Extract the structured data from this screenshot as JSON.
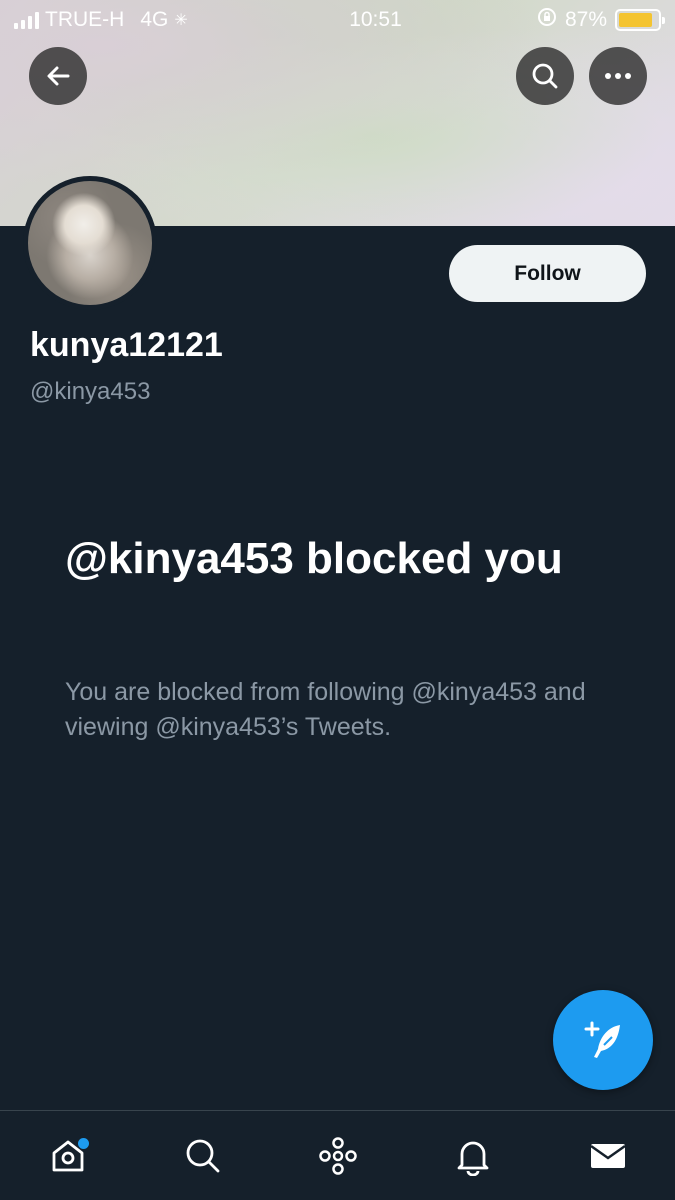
{
  "status_bar": {
    "carrier": "TRUE-H",
    "network": "4G",
    "time": "10:51",
    "battery": "87%",
    "battery_level": 0.87
  },
  "header": {
    "back_icon": "back-arrow-icon",
    "search_icon": "search-icon",
    "more_icon": "more-icon"
  },
  "profile": {
    "display_name": "kunya12121",
    "handle": "@kinya453",
    "follow_label": "Follow"
  },
  "blocked": {
    "title": "@kinya453 blocked you",
    "description": "You are blocked from following @kinya453 and viewing @kinya453’s Tweets."
  },
  "fab": {
    "icon": "compose-tweet-icon"
  },
  "tabs": [
    {
      "name": "home",
      "icon": "home-icon",
      "has_notification_dot": true
    },
    {
      "name": "search",
      "icon": "search-icon"
    },
    {
      "name": "spaces",
      "icon": "spaces-icon"
    },
    {
      "name": "notifications",
      "icon": "bell-icon"
    },
    {
      "name": "messages",
      "icon": "mail-icon"
    }
  ],
  "colors": {
    "background": "#15202b",
    "accent": "#1d9bf0",
    "secondary_text": "#8b98a5",
    "follow_button_bg": "#eff3f4"
  }
}
